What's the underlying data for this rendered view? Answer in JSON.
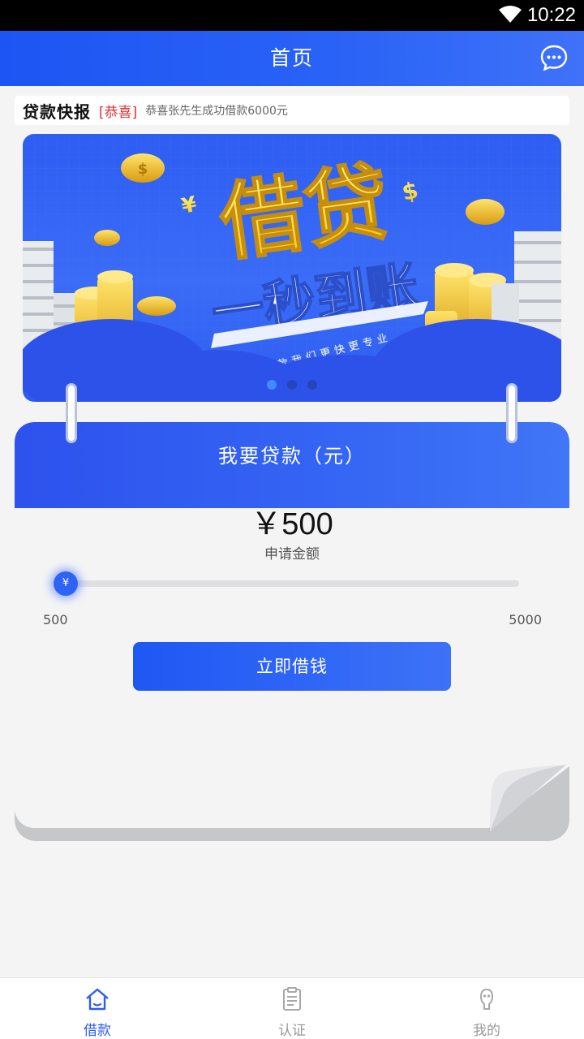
{
  "status_bar": {
    "time": "10:22"
  },
  "header": {
    "title": "首页",
    "message_icon": "chat-bubble-icon"
  },
  "ticker": {
    "label": "贷款快报",
    "tag": "[恭喜]",
    "text": "恭喜张先生成功借款6000元"
  },
  "banner": {
    "headline": "借贷",
    "subheadline": "一秒到账",
    "tagline": "小额贷款我们更快更专业",
    "slides": 3,
    "active_slide": 1
  },
  "loan_card": {
    "title": "我要贷款（元）",
    "amount": "￥500",
    "amount_caption": "申请金额",
    "slider": {
      "min": 500,
      "max": 5000,
      "value": 500,
      "min_label": "500",
      "max_label": "5000"
    },
    "thumb_symbol": "¥",
    "button_label": "立即借钱"
  },
  "tabbar": {
    "items": [
      {
        "label": "借款",
        "icon": "home-icon",
        "active": true
      },
      {
        "label": "认证",
        "icon": "document-icon",
        "active": false
      },
      {
        "label": "我的",
        "icon": "profile-icon",
        "active": false
      }
    ]
  },
  "colors": {
    "accent": "#2b5cf3",
    "tag_red": "#e53030"
  }
}
